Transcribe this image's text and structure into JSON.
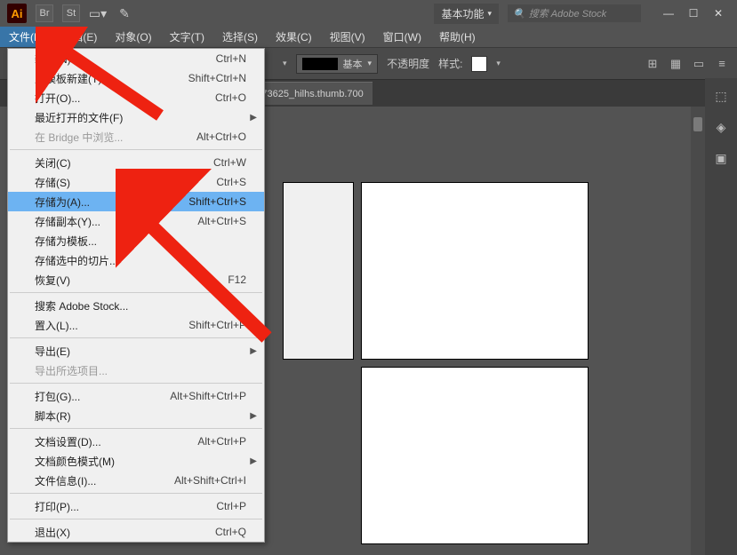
{
  "app": {
    "logo": "Ai",
    "workspace": "基本功能",
    "search_placeholder": "搜索 Adobe Stock"
  },
  "menu": [
    "文件(F)",
    "编辑(E)",
    "对象(O)",
    "文字(T)",
    "选择(S)",
    "效果(C)",
    "视图(V)",
    "窗口(W)",
    "帮助(H)"
  ],
  "control": {
    "stroke_label": "基本",
    "opacity_label": "不透明度",
    "style_label": "样式:"
  },
  "tab": {
    "title": "%2Fuploads%2Fitem%2F201808%2F02%2F20180802173625_hilhs.thumb.700"
  },
  "dropdown": [
    {
      "type": "item",
      "label": "新建(N)...",
      "shortcut": "Ctrl+N"
    },
    {
      "type": "item",
      "label": "从模板新建(T)...",
      "shortcut": "Shift+Ctrl+N"
    },
    {
      "type": "item",
      "label": "打开(O)...",
      "shortcut": "Ctrl+O"
    },
    {
      "type": "item",
      "label": "最近打开的文件(F)",
      "submenu": true
    },
    {
      "type": "item",
      "label": "在 Bridge 中浏览...",
      "shortcut": "Alt+Ctrl+O",
      "disabled": true
    },
    {
      "type": "sep"
    },
    {
      "type": "item",
      "label": "关闭(C)",
      "shortcut": "Ctrl+W"
    },
    {
      "type": "item",
      "label": "存储(S)",
      "shortcut": "Ctrl+S"
    },
    {
      "type": "item",
      "label": "存储为(A)...",
      "shortcut": "Shift+Ctrl+S",
      "highlighted": true
    },
    {
      "type": "item",
      "label": "存储副本(Y)...",
      "shortcut": "Alt+Ctrl+S"
    },
    {
      "type": "item",
      "label": "存储为模板..."
    },
    {
      "type": "item",
      "label": "存储选中的切片..."
    },
    {
      "type": "item",
      "label": "恢复(V)",
      "shortcut": "F12"
    },
    {
      "type": "sep"
    },
    {
      "type": "item",
      "label": "搜索 Adobe Stock..."
    },
    {
      "type": "item",
      "label": "置入(L)...",
      "shortcut": "Shift+Ctrl+P"
    },
    {
      "type": "sep"
    },
    {
      "type": "item",
      "label": "导出(E)",
      "submenu": true
    },
    {
      "type": "item",
      "label": "导出所选项目...",
      "disabled": true
    },
    {
      "type": "sep"
    },
    {
      "type": "item",
      "label": "打包(G)...",
      "shortcut": "Alt+Shift+Ctrl+P"
    },
    {
      "type": "item",
      "label": "脚本(R)",
      "submenu": true
    },
    {
      "type": "sep"
    },
    {
      "type": "item",
      "label": "文档设置(D)...",
      "shortcut": "Alt+Ctrl+P"
    },
    {
      "type": "item",
      "label": "文档颜色模式(M)",
      "submenu": true
    },
    {
      "type": "item",
      "label": "文件信息(I)...",
      "shortcut": "Alt+Shift+Ctrl+I"
    },
    {
      "type": "sep"
    },
    {
      "type": "item",
      "label": "打印(P)...",
      "shortcut": "Ctrl+P"
    },
    {
      "type": "sep"
    },
    {
      "type": "item",
      "label": "退出(X)",
      "shortcut": "Ctrl+Q"
    }
  ]
}
